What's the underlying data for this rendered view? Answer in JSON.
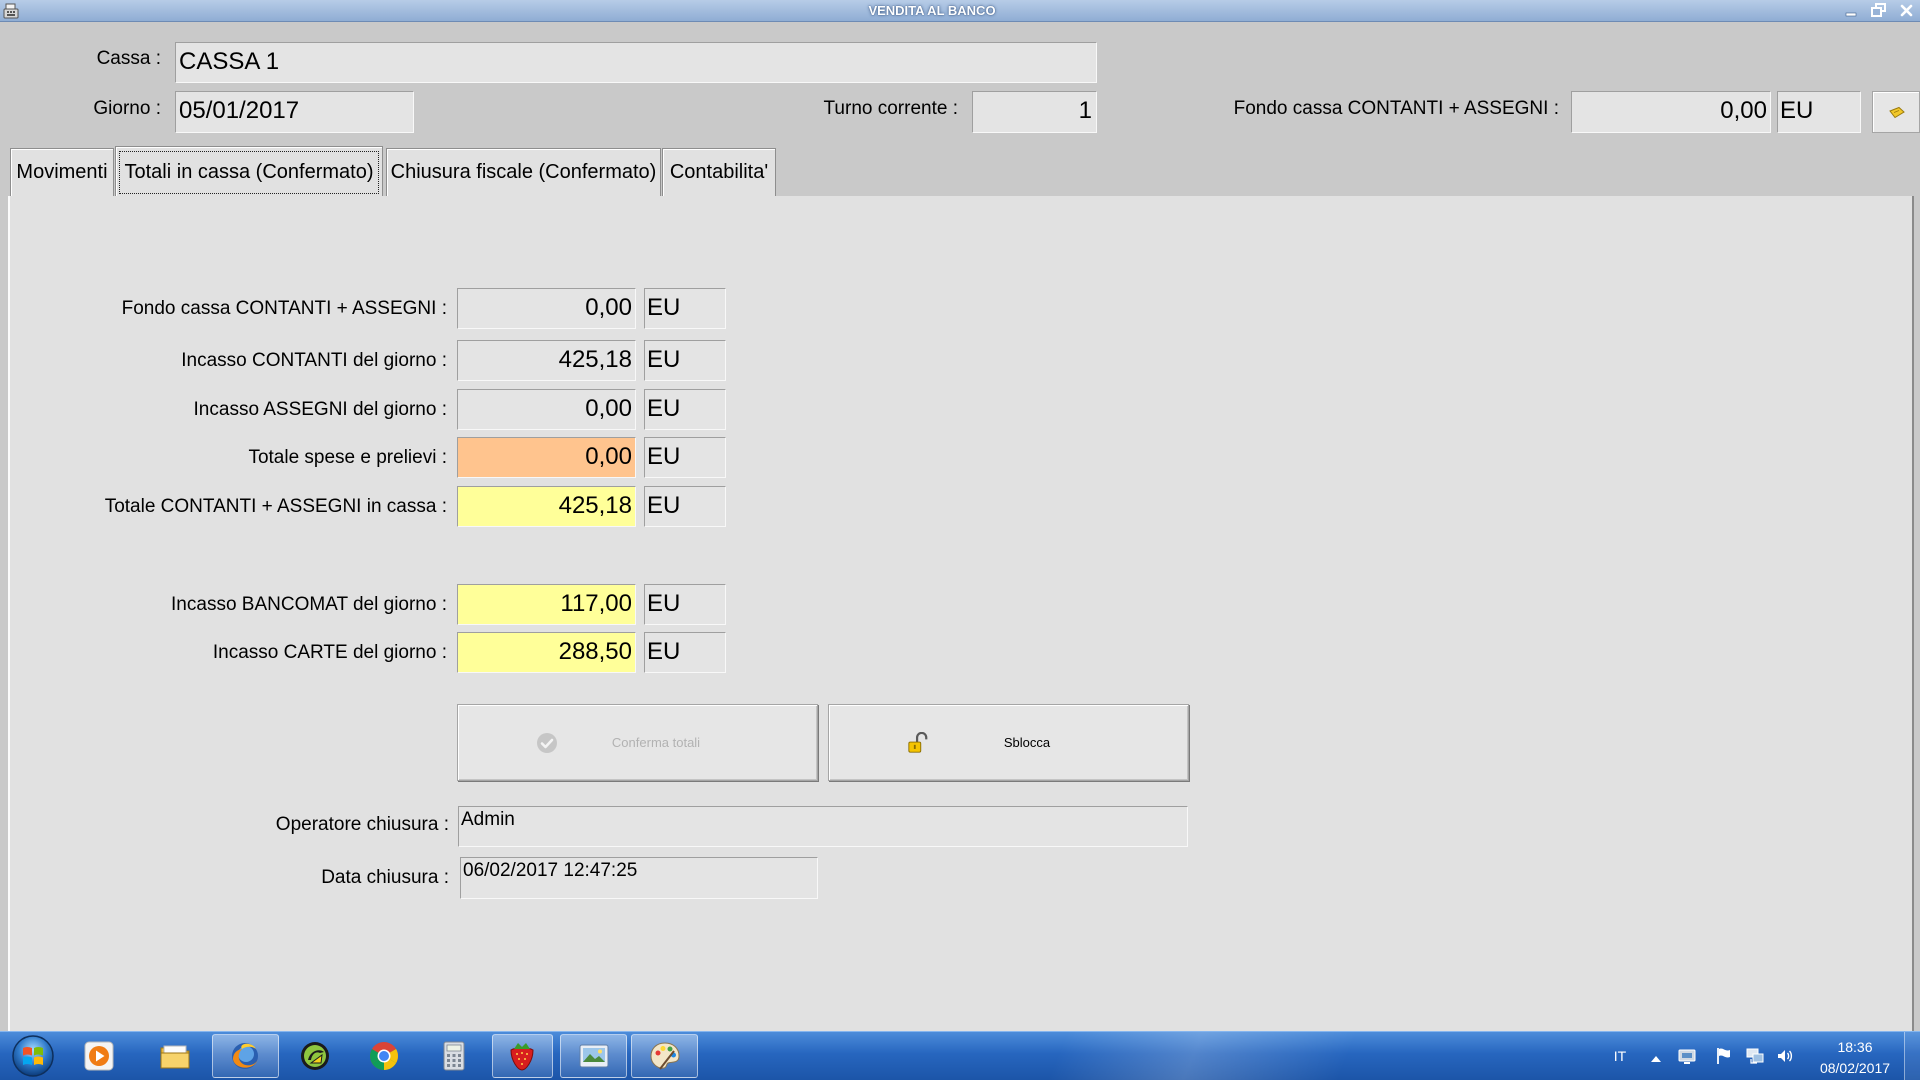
{
  "window": {
    "title": "VENDITA AL BANCO",
    "icon": "cash-register-icon"
  },
  "header": {
    "cassa": {
      "label": "Cassa :",
      "value": "CASSA 1"
    },
    "giorno": {
      "label": "Giorno :",
      "value": "05/01/2017"
    },
    "turno": {
      "label": "Turno corrente :",
      "value": "1"
    },
    "fondo": {
      "label": "Fondo cassa CONTANTI + ASSEGNI :",
      "value": "0,00",
      "currency": "EU",
      "button_icon": "cash-icon"
    }
  },
  "tabs": [
    {
      "label": "Movimenti",
      "active": false
    },
    {
      "label": "Totali in cassa (Confermato)",
      "active": true
    },
    {
      "label": "Chiusura fiscale (Confermato)",
      "active": false
    },
    {
      "label": "Contabilita'",
      "active": false
    }
  ],
  "totals": {
    "rows": [
      {
        "label": "Fondo cassa CONTANTI + ASSEGNI :",
        "value": "0,00",
        "currency": "EU",
        "fill": "#e4e4e4"
      },
      {
        "label": "Incasso CONTANTI del giorno :",
        "value": "425,18",
        "currency": "EU",
        "fill": "#e4e4e4"
      },
      {
        "label": "Incasso ASSEGNI del giorno :",
        "value": "0,00",
        "currency": "EU",
        "fill": "#e4e4e4"
      },
      {
        "label": "Totale spese e prelievi :",
        "value": "0,00",
        "currency": "EU",
        "fill": "#ffc48e"
      },
      {
        "label": "Totale CONTANTI + ASSEGNI in cassa :",
        "value": "425,18",
        "currency": "EU",
        "fill": "#ffff99"
      },
      {
        "label": "Incasso BANCOMAT del giorno :",
        "value": "117,00",
        "currency": "EU",
        "fill": "#ffff99"
      },
      {
        "label": "Incasso CARTE del giorno :",
        "value": "288,50",
        "currency": "EU",
        "fill": "#ffff99"
      }
    ]
  },
  "actions": {
    "confirm": {
      "label": "Conferma totali",
      "icon": "check-circle-icon",
      "enabled": false
    },
    "unlock": {
      "label": "Sblocca",
      "icon": "unlocked-padlock-icon",
      "enabled": true
    }
  },
  "closing": {
    "operator": {
      "label": "Operatore chiusura :",
      "value": "Admin"
    },
    "date": {
      "label": "Data chiusura :",
      "value": "06/02/2017 12:47:25"
    }
  },
  "taskbar": {
    "apps": [
      "windows-start-icon",
      "media-player-icon",
      "file-explorer-icon",
      "firefox-icon",
      "green-app-icon",
      "chrome-icon",
      "calculator-icon",
      "strawberry-app-icon",
      "image-viewer-icon",
      "paint-icon"
    ],
    "language": "IT",
    "time": "18:36",
    "date": "08/02/2017"
  },
  "colors": {
    "titlebar": "#8fadd4",
    "window_bg": "#c9c9c9",
    "panel_bg": "#e1e1e1",
    "taskbar": "#2766bf"
  }
}
